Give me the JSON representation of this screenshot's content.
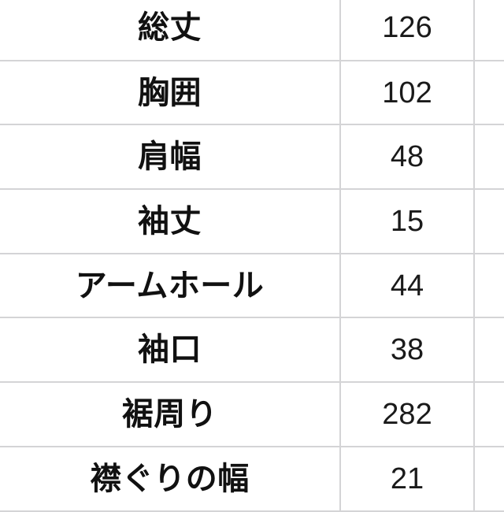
{
  "table": {
    "columns": [
      {
        "key": "label",
        "header": ""
      },
      {
        "key": "value",
        "header": ""
      },
      {
        "key": "extra",
        "header": ""
      }
    ],
    "rows": [
      {
        "label": "総丈",
        "value": "126"
      },
      {
        "label": "胸囲",
        "value": "102"
      },
      {
        "label": "肩幅",
        "value": "48"
      },
      {
        "label": "袖丈",
        "value": "15"
      },
      {
        "label": "アームホール",
        "value": "44"
      },
      {
        "label": "袖口",
        "value": "38"
      },
      {
        "label": "裾周り",
        "value": "282"
      },
      {
        "label": "襟ぐりの幅",
        "value": "21"
      }
    ]
  },
  "colors": {
    "background": "#ffffff",
    "border": "#d4d4d6",
    "label_text": "#111111",
    "value_text": "#1a1a1a"
  }
}
